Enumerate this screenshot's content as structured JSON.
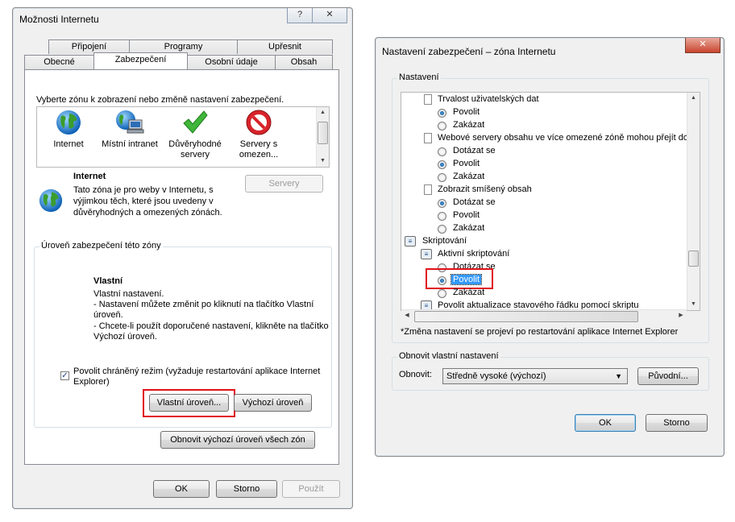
{
  "left_window": {
    "title": "Možnosti Internetu",
    "help_button": "?",
    "close_button": "✕",
    "tabs_row_back": [
      "Připojení",
      "Programy",
      "Upřesnit"
    ],
    "tabs_row_front": [
      "Obecné",
      "Zabezpečení",
      "Osobní údaje",
      "Obsah"
    ],
    "zone_prompt": "Vyberte zónu k zobrazení nebo změně nastavení zabezpečení.",
    "zones": {
      "internet": [
        "Internet"
      ],
      "intranet": [
        "Místní intranet"
      ],
      "trusted": [
        "Důvěryhodné",
        "servery"
      ],
      "restricted": [
        "Servery s",
        "omezen..."
      ]
    },
    "zone_info": {
      "name": "Internet",
      "description": [
        "Tato zóna je pro weby v Internetu, s",
        "výjimkou těch, které jsou uvedeny v",
        "důvěryhodných a omezených zónách."
      ],
      "servers_button": "Servery"
    },
    "security_level": {
      "group_label": "Úroveň zabezpečení této zóny",
      "level_title": "Vlastní",
      "level_text": [
        "Vlastní nastavení.",
        "- Nastavení můžete změnit po kliknutí na tlačítko Vlastní",
        "úroveň.",
        "- Chcete-li použít doporučené nastavení, klikněte na tlačítko",
        "Výchozí úroveň."
      ],
      "protected_mode": [
        "Povolit chráněný režim (vyžaduje restartování aplikace Internet",
        "Explorer)"
      ],
      "custom_level_button": "Vlastní úroveň...",
      "default_level_button": "Výchozí úroveň"
    },
    "reset_all_button": "Obnovit výchozí úroveň všech zón",
    "ok_button": "OK",
    "cancel_button": "Storno",
    "apply_button": "Použít"
  },
  "right_window": {
    "title": "Nastavení zabezpečení – zóna Internetu",
    "close_button": "✕",
    "settings_group_label": "Nastavení",
    "tree": {
      "item1": "Trvalost uživatelských dat",
      "item1_opt1": "Povolit",
      "item1_opt2": "Zakázat",
      "item2": "Webové servery obsahu ve více omezené zóně mohou přejít do",
      "item2_opt1": "Dotázat se",
      "item2_opt2": "Povolit",
      "item2_opt3": "Zakázat",
      "item3": "Zobrazit smíšený obsah",
      "item3_opt1": "Dotázat se",
      "item3_opt2": "Povolit",
      "item3_opt3": "Zakázat",
      "category": "Skriptování",
      "item4": "Aktivní skriptování",
      "item4_opt1": "Dotázat se",
      "item4_opt2": "Povolit",
      "item4_opt3": "Zakázat",
      "item5": "Povolit aktualizace stavového řádku pomocí skriptu"
    },
    "restart_note": "*Změna nastavení se projeví po restartování aplikace Internet Explorer",
    "reset_group_label": "Obnovit vlastní nastavení",
    "reset_label": "Obnovit:",
    "reset_value": "Středně vysoké (výchozí)",
    "reset_button": "Původní...",
    "ok_button": "OK",
    "cancel_button": "Storno"
  }
}
